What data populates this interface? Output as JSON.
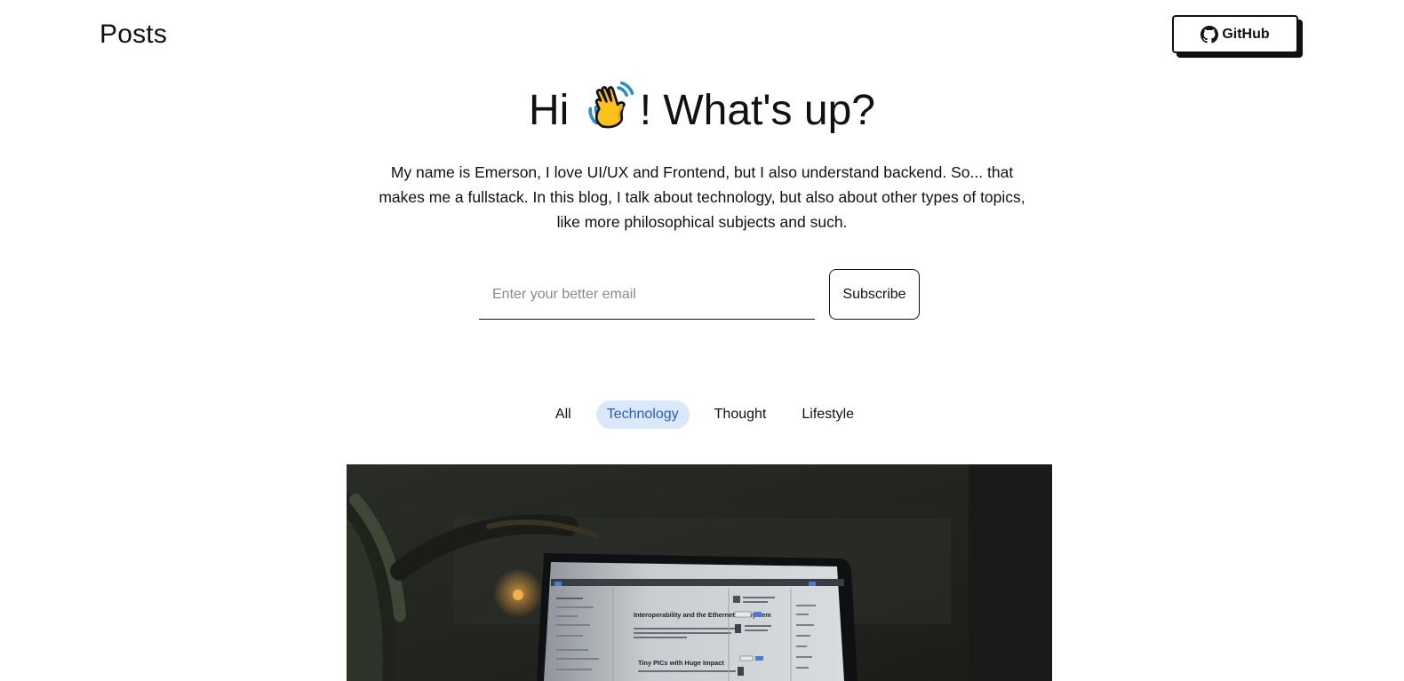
{
  "header": {
    "brand": "Posts",
    "github_label": "GitHub"
  },
  "hero": {
    "title_before": "Hi",
    "title_after": "! What's up?",
    "intro": "My name is Emerson, I love UI/UX and Frontend, but I also understand backend. So... that makes me a fullstack. In this blog, I talk about technology, but also about other types of topics, like more philosophical subjects and such."
  },
  "subscribe": {
    "placeholder": "Enter your better email",
    "value": "",
    "button_label": "Subscribe"
  },
  "filters": {
    "tabs": [
      {
        "label": "All",
        "active": false
      },
      {
        "label": "Technology",
        "active": true
      },
      {
        "label": "Thought",
        "active": false
      },
      {
        "label": "Lifestyle",
        "active": false
      }
    ]
  },
  "featured": {
    "screen_headline": "Interoperability and the Ethernet Ecosystem",
    "screen_subheadline": "Tiny PICs with Huge Impact"
  },
  "colors": {
    "accent_bg": "#dbe8fb",
    "accent_text": "#2b5cc6",
    "text": "#111111"
  }
}
